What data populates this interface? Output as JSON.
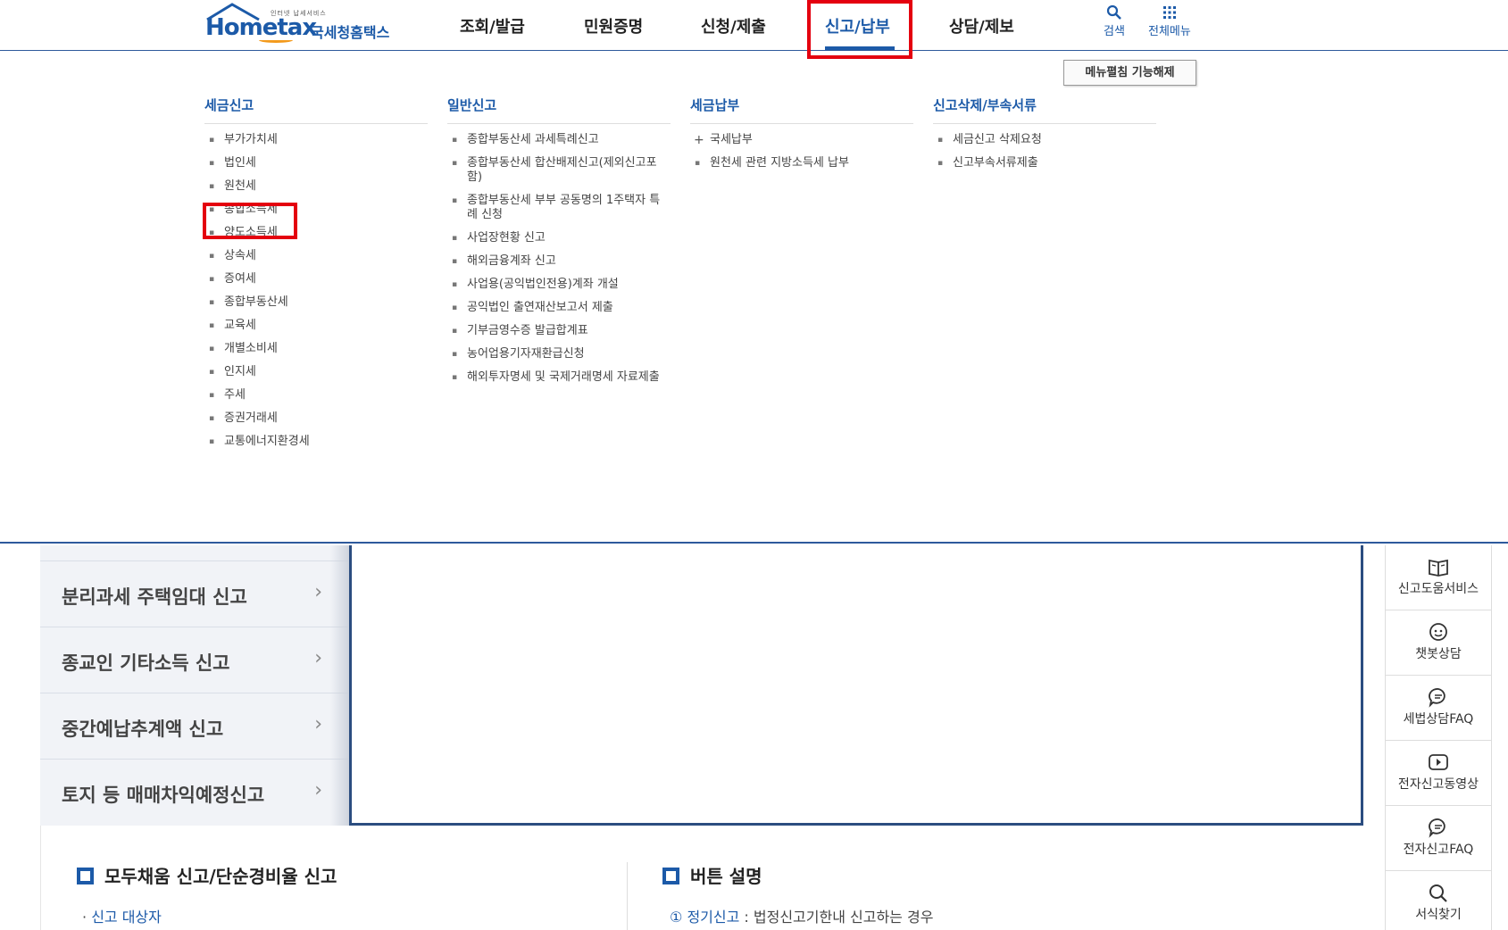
{
  "header": {
    "logo": {
      "top_text": "인터넷 납세서비스",
      "main_text": "Hometax",
      "korean": "국세청홈택스"
    },
    "gnb": [
      "조회/발급",
      "민원증명",
      "신청/제출",
      "신고/납부",
      "상담/제보"
    ],
    "active_gnb": "신고/납부",
    "util": {
      "search": "검색",
      "all_menu": "전체메뉴"
    }
  },
  "mega_menu": {
    "collapse_button": "메뉴펼침 기능해제",
    "columns": [
      {
        "title": "세금신고",
        "items": [
          "부가가치세",
          "법인세",
          "원천세",
          "종합소득세",
          "양도소득세",
          "상속세",
          "증여세",
          "종합부동산세",
          "교육세",
          "개별소비세",
          "인지세",
          "주세",
          "증권거래세",
          "교통에너지환경세"
        ]
      },
      {
        "title": "일반신고",
        "items": [
          "종합부동산세 과세특례신고",
          "종합부동산세 합산배제신고(제외신고포함)",
          "종합부동산세 부부 공동명의 1주택자 특례 신청",
          "사업장현황 신고",
          "해외금융계좌 신고",
          "사업용(공익법인전용)계좌 개설",
          "공익법인 출연재산보고서 제출",
          "기부금영수증 발급합계표",
          "농어업용기자재환급신청",
          "해외투자명세 및 국제거래명세 자료제출"
        ]
      },
      {
        "title": "세금납부",
        "items": [
          "국세납부",
          "원천세 관련 지방소득세 납부"
        ]
      },
      {
        "title": "신고삭제/부속서류",
        "items": [
          "세금신고 삭제요청",
          "신고부속서류제출"
        ]
      }
    ]
  },
  "left_menu": [
    "분리과세 주택임대 신고",
    "종교인 기타소득 신고",
    "중간예납추계액 신고",
    "토지 등 매매차익예정신고"
  ],
  "side_menu": [
    "신고도움서비스",
    "챗봇상담",
    "세법상담FAQ",
    "전자신고동영상",
    "전자신고FAQ",
    "서식찾기"
  ],
  "sections": {
    "left_title": "모두채움 신고/단순경비율 신고",
    "left_sub": "신고 대상자",
    "right_title": "버튼 설명",
    "right_num": "①",
    "right_key": "정기신고",
    "right_desc": " : 법정신고기한내 신고하는 경우"
  },
  "colors": {
    "brand": "#1c5aa8",
    "highlight": "#e4000f",
    "accent_orange": "#f39a1c"
  }
}
